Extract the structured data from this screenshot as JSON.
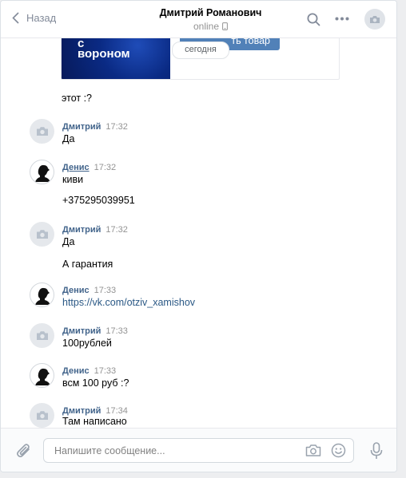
{
  "header": {
    "back_label": "Назад",
    "title": "Дмитрий Романович",
    "status": "online"
  },
  "attachment": {
    "image_line1": "с",
    "image_line2": "вороном",
    "button_label": "ть товар"
  },
  "date_divider": "сегодня",
  "loose_message": "этот :?",
  "messages": [
    {
      "author": "Дмитрий",
      "time": "17:32",
      "lines": [
        "Да"
      ]
    },
    {
      "author": "Денис",
      "time": "17:32",
      "lines": [
        "киви",
        "+375295039951"
      ]
    },
    {
      "author": "Дмитрий",
      "time": "17:32",
      "lines": [
        "Да",
        "А гарантия"
      ]
    },
    {
      "author": "Денис",
      "time": "17:33",
      "lines": [
        "https://vk.com/otziv_xamishov"
      ]
    },
    {
      "author": "Дмитрий",
      "time": "17:33",
      "lines": [
        "100рублей"
      ]
    },
    {
      "author": "Денис",
      "time": "17:33",
      "lines": [
        "всм 100 руб :?"
      ]
    },
    {
      "author": "Дмитрий",
      "time": "17:34",
      "lines": [
        "Там написано"
      ]
    }
  ],
  "composer": {
    "placeholder": "Напишите сообщение..."
  },
  "colors": {
    "accent": "#5181b8",
    "author": "#42648b",
    "link": "#2a5885"
  },
  "icons": [
    "chevron-left-icon",
    "phone-icon",
    "search-icon",
    "more-icon",
    "camera-icon",
    "silhouette-icon",
    "paperclip-icon",
    "smile-icon",
    "microphone-icon"
  ]
}
